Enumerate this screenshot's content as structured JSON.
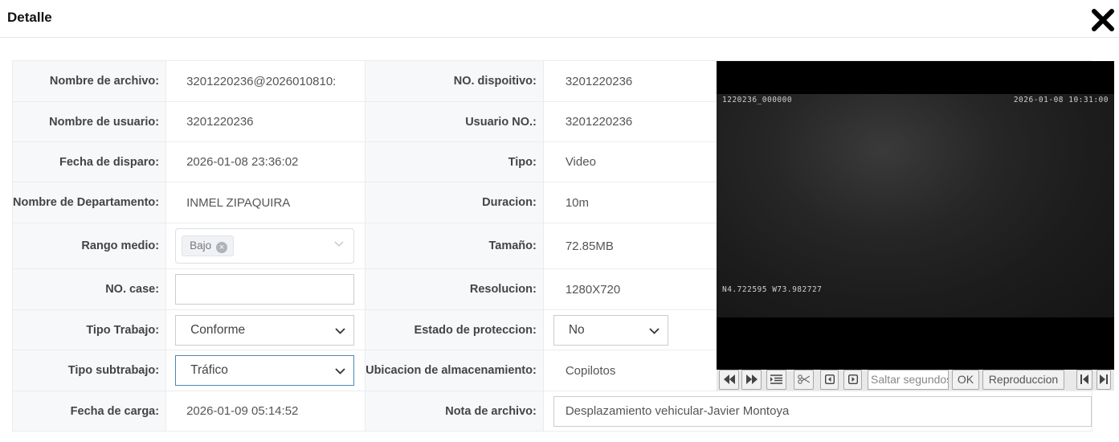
{
  "header": {
    "title": "Detalle"
  },
  "form": {
    "labels": {
      "file_name": "Nombre de archivo:",
      "device_no": "NO. dispoitivo:",
      "user_name": "Nombre de usuario:",
      "user_no": "Usuario NO.:",
      "trigger_date": "Fecha de disparo:",
      "type": "Tipo:",
      "department": "Nombre de Departamento:",
      "duration": "Duracion:",
      "media_range": "Rango medio:",
      "size": "Tamaño:",
      "case_no": "NO. case:",
      "resolution": "Resolucion:",
      "work_type": "Tipo Trabajo:",
      "protection_state": "Estado de proteccion:",
      "work_subtype": "Tipo subtrabajo:",
      "storage_location": "Ubicacion de almacenamiento:",
      "upload_date": "Fecha de carga:",
      "file_note": "Nota de archivo:"
    },
    "values": {
      "file_name": "3201220236@2026010810:",
      "device_no": "3201220236",
      "user_name": "3201220236",
      "user_no": "3201220236",
      "trigger_date": "2026-01-08 23:36:02",
      "type": "Video",
      "department": "INMEL ZIPAQUIRA",
      "duration": "10m",
      "media_range_tag": "Bajo",
      "size": "72.85MB",
      "case_no": "",
      "resolution": "1280X720",
      "work_type": "Conforme",
      "protection_state": "No",
      "work_subtype": "Tráfico",
      "storage_location": "Copilotos",
      "upload_date": "2026-01-09 05:14:52",
      "file_note": "Desplazamiento vehicular-Javier Montoya"
    }
  },
  "video": {
    "overlay_top_left": "1220236_000000",
    "overlay_top_right": "2026-01-08 10:31:00",
    "overlay_bottom_left": "N4.722595 W73.982727"
  },
  "player": {
    "seek_placeholder": "Saltar segundos",
    "ok_label": "OK",
    "play_label": "Reproduccion"
  },
  "icons": {
    "close": "close-icon",
    "rewind": "rewind-icon",
    "fast_forward": "fast-forward-icon",
    "list": "list-icon",
    "cut": "scissors-icon",
    "prev_frame": "prev-frame-icon",
    "next_frame": "next-frame-icon",
    "skip_start": "skip-start-icon",
    "skip_end": "skip-end-icon"
  }
}
